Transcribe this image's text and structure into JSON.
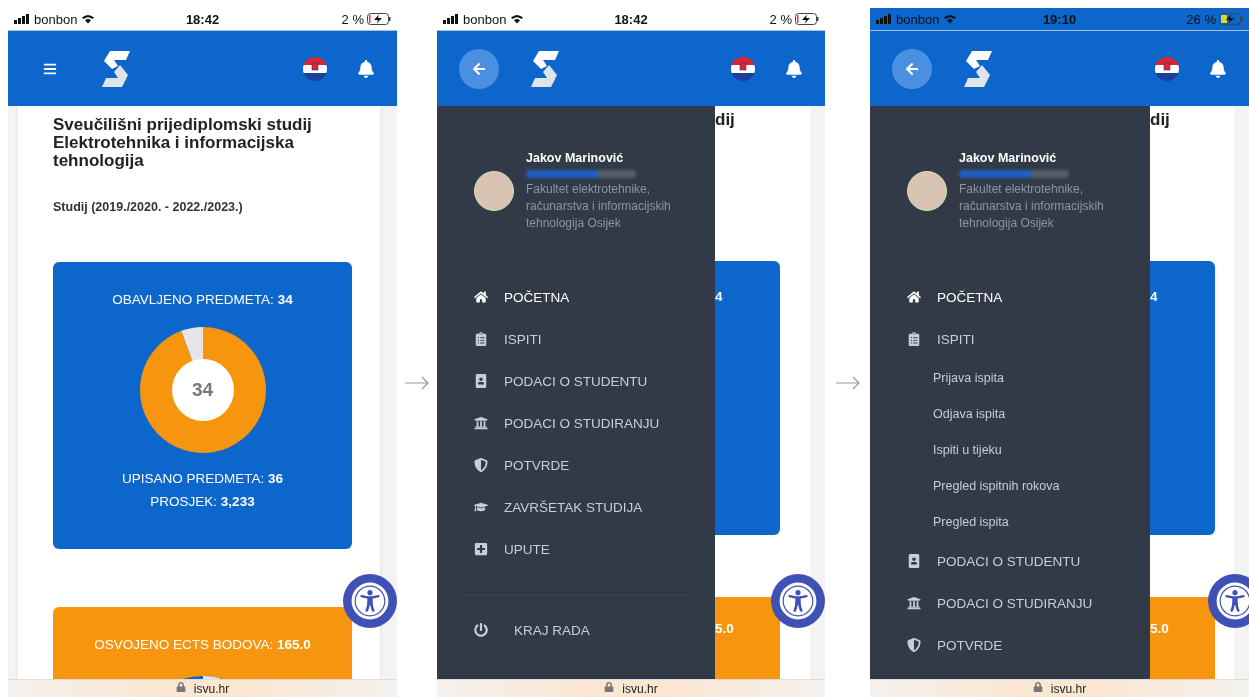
{
  "phones": [
    {
      "kind": "home",
      "status_bar": {
        "carrier": "bonbon",
        "time": "18:42",
        "battery": "2 %",
        "tinted": false
      },
      "header": {
        "nav_button": {
          "kind": "menu"
        }
      },
      "content": {
        "title": "Sveučilišni prijediplomski studij Elektrotehnika i informacijska tehnologija",
        "period": "Studij (2019./2020. - 2022./2023.)",
        "cards": [
          {
            "kind": "courses",
            "heading": "OBAVLJENO PREDMETA: **34**",
            "center": "34",
            "chart_data": {
              "type": "donut",
              "values": [
                94.4,
                5.6
              ]
            },
            "lines": [
              "UPISANO PREDMETA: **36**",
              "PROSJEK: **3,233**"
            ]
          },
          {
            "kind": "ects",
            "heading": "OSVOJENO ECTS BODOVA: **165.0**"
          }
        ]
      },
      "url": "isvu.hr"
    },
    {
      "kind": "drawer",
      "status_bar": {
        "carrier": "bonbon",
        "time": "18:42",
        "battery": "2 %",
        "tinted": false
      },
      "header": {
        "nav_button": {
          "kind": "back"
        }
      },
      "behind": {
        "title_tail": "dij",
        "card_tail": "4",
        "ects_tail": "5.0"
      },
      "drawer": {
        "user": {
          "name": "Jakov Marinović",
          "faculty": "Fakultet elektrotehnike, računarstva i informacijskih tehnologija Osijek"
        },
        "items": [
          {
            "label": "POČETNA",
            "kind": "home",
            "selected": true
          },
          {
            "label": "ISPITI",
            "kind": "exams",
            "selected": false
          },
          {
            "label": "PODACI O STUDENTU",
            "kind": "student",
            "selected": false
          },
          {
            "label": "PODACI O STUDIRANJU",
            "kind": "studies",
            "selected": false
          },
          {
            "label": "POTVRDE",
            "kind": "certificates",
            "selected": false
          },
          {
            "label": "ZAVRŠETAK STUDIJA",
            "kind": "graduation",
            "selected": false
          },
          {
            "label": "UPUTE",
            "kind": "help",
            "selected": false
          }
        ],
        "footer": {
          "label": "KRAJ RADA"
        }
      },
      "url": "isvu.hr"
    },
    {
      "kind": "drawer",
      "status_bar": {
        "carrier": "bonbon",
        "time": "19:10",
        "battery": "26 %",
        "tinted": true
      },
      "header": {
        "nav_button": {
          "kind": "back"
        }
      },
      "behind": {
        "title_tail": "dij",
        "card_tail": "4",
        "ects_tail": "5.0"
      },
      "drawer": {
        "user": {
          "name": "Jakov Marinović",
          "faculty": "Fakultet elektrotehnike, računarstva i informacijskih tehnologija Osijek"
        },
        "items": [
          {
            "label": "POČETNA",
            "kind": "home",
            "selected": true
          },
          {
            "label": "ISPITI",
            "kind": "exams",
            "selected": false,
            "children": [
              {
                "label": "Prijava ispita"
              },
              {
                "label": "Odjava ispita"
              },
              {
                "label": "Ispiti u tijeku"
              },
              {
                "label": "Pregled ispitnih rokova"
              },
              {
                "label": "Pregled ispita"
              }
            ]
          },
          {
            "label": "PODACI O STUDENTU",
            "kind": "student",
            "selected": false
          },
          {
            "label": "PODACI O STUDIRANJU",
            "kind": "studies",
            "selected": false
          },
          {
            "label": "POTVRDE",
            "kind": "certificates",
            "selected": false
          }
        ]
      },
      "url": "isvu.hr"
    }
  ]
}
